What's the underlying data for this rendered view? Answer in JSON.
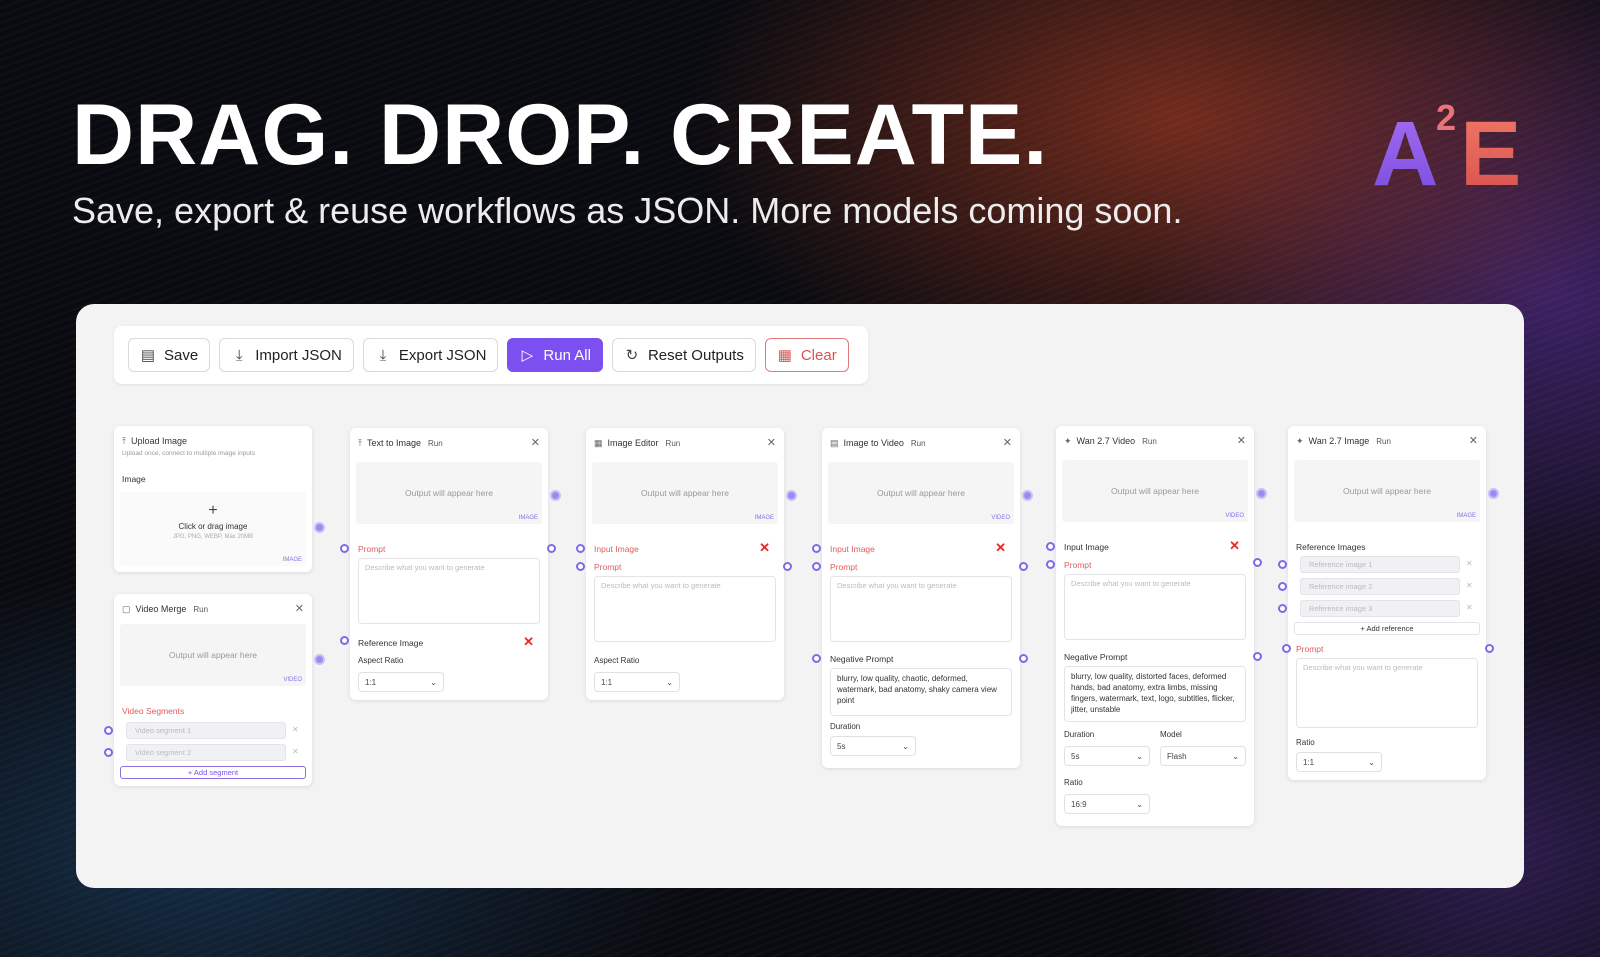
{
  "hero": {
    "headline": "DRAG. DROP. CREATE.",
    "subline": "Save, export & reuse workflows as JSON. More models coming soon.",
    "logo": {
      "a": "A",
      "sup": "2",
      "e": "E"
    }
  },
  "toolbar": {
    "save": "Save",
    "import": "Import JSON",
    "export": "Export JSON",
    "run_all": "Run All",
    "reset": "Reset Outputs",
    "clear": "Clear"
  },
  "nodes": {
    "upload": {
      "title": "Upload Image",
      "hint": "Upload once, connect to multiple image inputs",
      "field": "Image",
      "drop_label": "Click or drag image",
      "drop_hint": "JPG, PNG, WEBP, Max 20MB",
      "tag": "IMAGE"
    },
    "video_merge": {
      "title": "Video Merge",
      "run": "Run",
      "output": "Output will appear here",
      "tag": "VIDEO",
      "segments_label": "Video Segments",
      "segment1": "Video segment 1",
      "segment2": "Video segment 2",
      "add": "+ Add segment"
    },
    "text_to_image": {
      "title": "Text to Image",
      "run": "Run",
      "output": "Output will appear here",
      "tag": "IMAGE",
      "prompt_label": "Prompt",
      "prompt_placeholder": "Describe what you want to generate",
      "ref_label": "Reference Image",
      "ratio_label": "Aspect Ratio",
      "ratio_value": "1:1"
    },
    "image_editor": {
      "title": "Image Editor",
      "run": "Run",
      "output": "Output will appear here",
      "tag": "IMAGE",
      "input_label": "Input Image",
      "prompt_label": "Prompt",
      "prompt_placeholder": "Describe what you want to generate",
      "ratio_label": "Aspect Ratio",
      "ratio_value": "1:1"
    },
    "image_to_video": {
      "title": "Image to Video",
      "run": "Run",
      "output": "Output will appear here",
      "tag": "VIDEO",
      "input_label": "Input Image",
      "prompt_label": "Prompt",
      "prompt_placeholder": "Describe what you want to generate",
      "neg_label": "Negative Prompt",
      "neg_value": "blurry, low quality, chaotic, deformed, watermark, bad anatomy, shaky camera view point",
      "duration_label": "Duration",
      "duration_value": "5s"
    },
    "wan_video": {
      "title": "Wan 2.7 Video",
      "run": "Run",
      "output": "Output will appear here",
      "tag": "VIDEO",
      "input_label": "Input Image",
      "prompt_label": "Prompt",
      "prompt_placeholder": "Describe what you want to generate",
      "neg_label": "Negative Prompt",
      "neg_value": "blurry, low quality, distorted faces, deformed hands, bad anatomy, extra limbs, missing fingers, watermark, text, logo, subtitles, flicker, jitter, unstable",
      "duration_label": "Duration",
      "duration_value": "5s",
      "model_label": "Model",
      "model_value": "Flash",
      "ratio_label": "Ratio",
      "ratio_value": "16:9"
    },
    "wan_image": {
      "title": "Wan 2.7 Image",
      "run": "Run",
      "output": "Output will appear here",
      "tag": "IMAGE",
      "refs_label": "Reference Images",
      "ref1": "Reference image 1",
      "ref2": "Reference image 2",
      "ref3": "Reference image 3",
      "add": "+ Add reference",
      "prompt_label": "Prompt",
      "prompt_placeholder": "Describe what you want to generate",
      "ratio_label": "Ratio",
      "ratio_value": "1:1"
    }
  }
}
